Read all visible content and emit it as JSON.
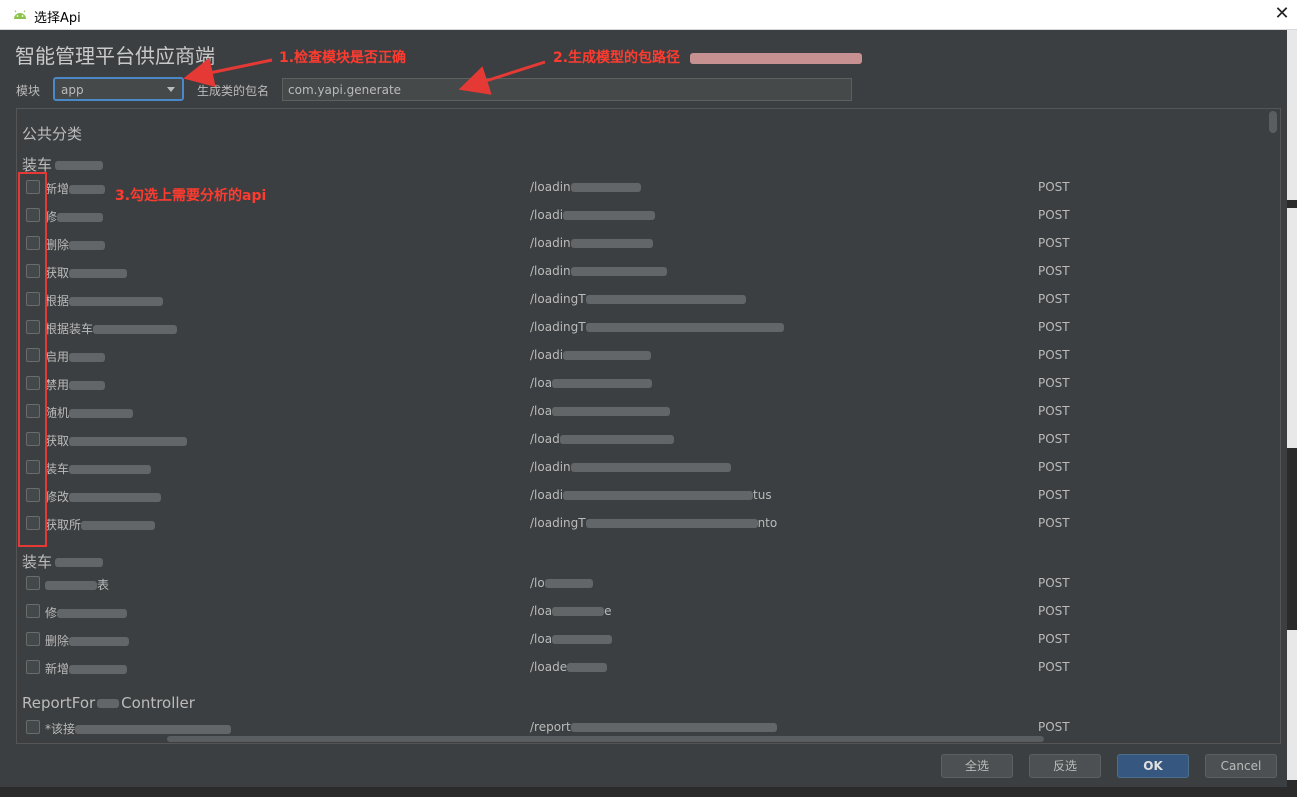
{
  "window": {
    "title": "选择Api",
    "close": "✕"
  },
  "heading": "智能管理平台供应商端",
  "form": {
    "module_label": "模块",
    "module_value": "app",
    "package_label": "生成类的包名",
    "package_value": "com.yapi.generate"
  },
  "annotations": {
    "a1": "1.检查模块是否正确",
    "a2": "2.生成模型的包路径",
    "a3": "3.勾选上需要分析的api"
  },
  "list": {
    "root": "公共分类",
    "groups": [
      {
        "name": "装车",
        "rows": [
          {
            "name": "新增",
            "path": "/loadin",
            "method": "POST"
          },
          {
            "name": "修",
            "path": "/loadi",
            "method": "POST"
          },
          {
            "name": "删除",
            "path": "/loadin",
            "method": "POST"
          },
          {
            "name": "获取",
            "path": "/loadin",
            "method": "POST"
          },
          {
            "name": "根据",
            "path": "/loadingT",
            "method": "POST"
          },
          {
            "name": "根据装车",
            "path": "/loadingT",
            "method": "POST"
          },
          {
            "name": "启用",
            "path": "/loadi",
            "method": "POST"
          },
          {
            "name": "禁用",
            "path": "/loa",
            "method": "POST"
          },
          {
            "name": "随机",
            "path": "/loa",
            "method": "POST"
          },
          {
            "name": "获取",
            "path": "/load",
            "method": "POST"
          },
          {
            "name": "装车",
            "path": "/loadin",
            "method": "POST"
          },
          {
            "name": "修改",
            "path": "/loadi",
            "suffix": "tus",
            "method": "POST"
          },
          {
            "name": "获取所",
            "path": "/loadingT",
            "suffix": "nto",
            "method": "POST"
          }
        ]
      },
      {
        "name": "装车",
        "rows": [
          {
            "name": "",
            "suffix_name": "表",
            "path": "/lo",
            "method": "POST"
          },
          {
            "name": "修",
            "path": "/loa",
            "suffix": "e",
            "method": "POST"
          },
          {
            "name": "删除",
            "path": "/loa",
            "method": "POST"
          },
          {
            "name": "新增",
            "path": "/loade",
            "method": "POST"
          }
        ]
      },
      {
        "name": "ReportFor",
        "name_suffix": "Controller",
        "rows": [
          {
            "name": "*该接",
            "path": "/report",
            "method": "POST"
          }
        ]
      }
    ]
  },
  "buttons": {
    "select_all": "全选",
    "invert": "反选",
    "ok": "OK",
    "cancel": "Cancel"
  },
  "colors": {
    "bg": "#3c3f41",
    "accent": "#4a88c7",
    "annotation": "#ff3b30"
  }
}
